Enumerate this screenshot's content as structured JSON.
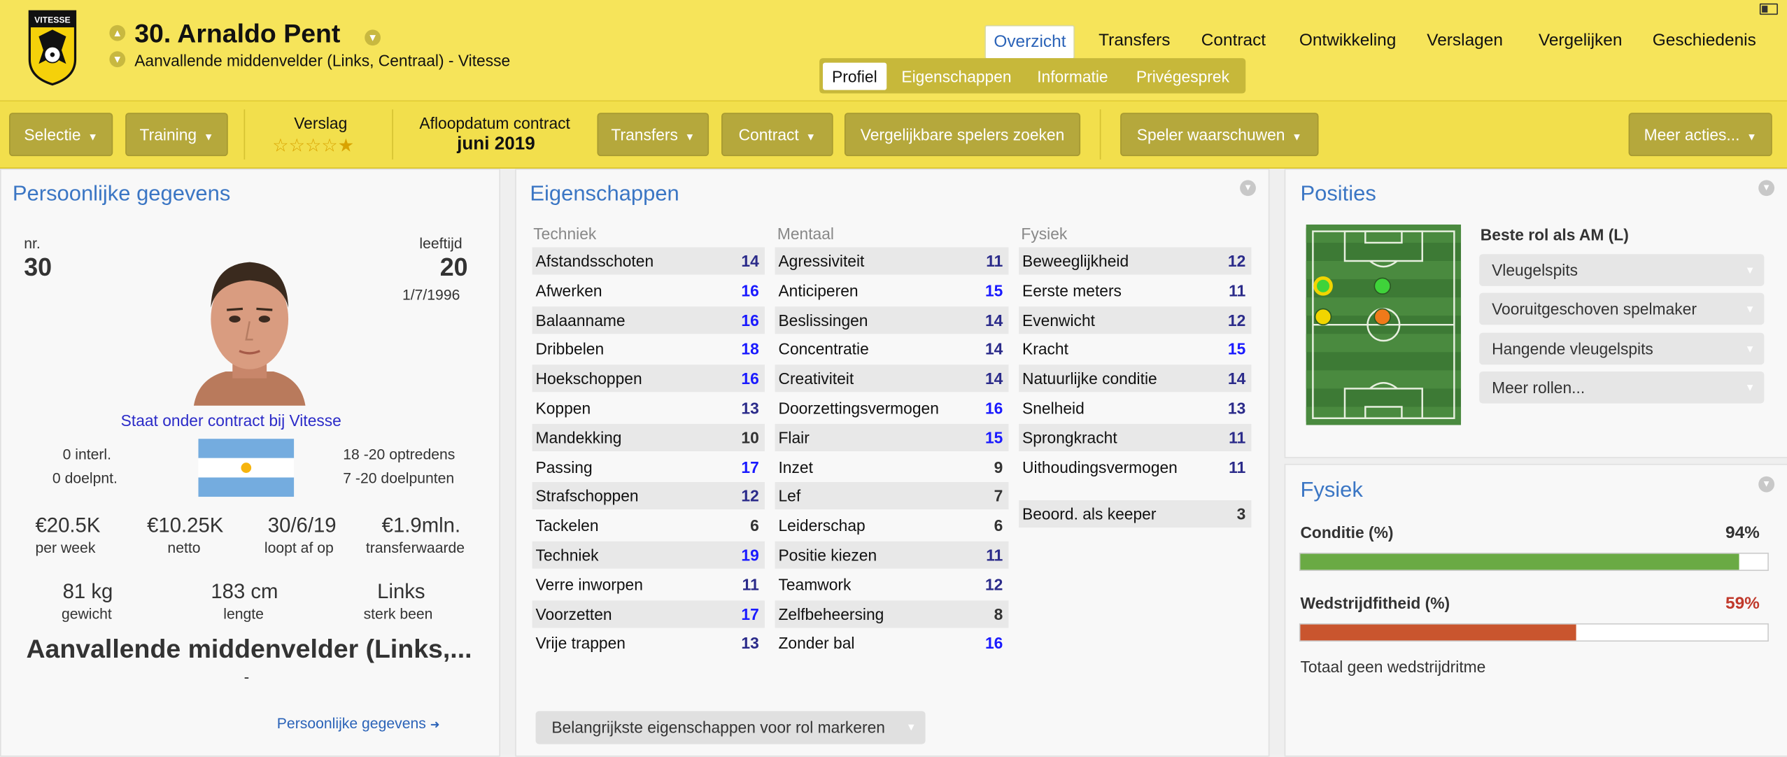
{
  "header": {
    "player_title": "30. Arnaldo Pent",
    "player_subtitle": "Aanvallende middenvelder (Links, Centraal) - Vitesse",
    "club_crest": "VITESSE",
    "nav_tabs": [
      "Overzicht",
      "Transfers",
      "Contract",
      "Ontwikkeling",
      "Verslagen",
      "Vergelijken",
      "Geschiedenis"
    ],
    "active_nav": "Overzicht",
    "sub_tabs": [
      "Profiel",
      "Eigenschappen",
      "Informatie",
      "Privégesprek"
    ],
    "active_sub": "Profiel"
  },
  "toolbar": {
    "selectie": "Selectie",
    "training": "Training",
    "verslag_label": "Verslag",
    "verslag_stars": 4.5,
    "contract_label": "Afloopdatum contract",
    "contract_value": "juni 2019",
    "transfers": "Transfers",
    "contract": "Contract",
    "vergelijkbare": "Vergelijkbare spelers zoeken",
    "waarschuwen": "Speler waarschuwen",
    "meer": "Meer acties..."
  },
  "personal": {
    "title": "Persoonlijke gegevens",
    "nr_label": "nr.",
    "nr": "30",
    "age_label": "leeftijd",
    "age": "20",
    "dob": "1/7/1996",
    "contract_status": "Staat onder contract bij Vitesse",
    "intl": "0 interl.",
    "intl_goals": "0 doelpnt.",
    "apps": "18 -20 optredens",
    "goals": "7 -20 doelpunten",
    "stats": [
      {
        "value": "€20.5K",
        "label": "per week"
      },
      {
        "value": "€10.25K",
        "label": "netto"
      },
      {
        "value": "30/6/19",
        "label": "loopt af op"
      },
      {
        "value": "€1.9mln.",
        "label": "transferwaarde"
      }
    ],
    "body": [
      {
        "value": "81 kg",
        "label": "gewicht"
      },
      {
        "value": "183 cm",
        "label": "lengte"
      },
      {
        "value": "Links",
        "label": "sterk been"
      }
    ],
    "position_big": "Aanvallende middenvelder (Links,...",
    "dash": "-",
    "link": "Persoonlijke gegevens",
    "link_arrow": "➜"
  },
  "attributes": {
    "title": "Eigenschappen",
    "techniek_head": "Techniek",
    "mentaal_head": "Mentaal",
    "fysiek_head": "Fysiek",
    "techniek": [
      {
        "name": "Afstandsschoten",
        "value": "14"
      },
      {
        "name": "Afwerken",
        "value": "16"
      },
      {
        "name": "Balaanname",
        "value": "16"
      },
      {
        "name": "Dribbelen",
        "value": "18"
      },
      {
        "name": "Hoekschoppen",
        "value": "16"
      },
      {
        "name": "Koppen",
        "value": "13"
      },
      {
        "name": "Mandekking",
        "value": "10"
      },
      {
        "name": "Passing",
        "value": "17"
      },
      {
        "name": "Strafschoppen",
        "value": "12"
      },
      {
        "name": "Tackelen",
        "value": "6"
      },
      {
        "name": "Techniek",
        "value": "19"
      },
      {
        "name": "Verre inworpen",
        "value": "11"
      },
      {
        "name": "Voorzetten",
        "value": "17"
      },
      {
        "name": "Vrije trappen",
        "value": "13"
      }
    ],
    "mentaal": [
      {
        "name": "Agressiviteit",
        "value": "11"
      },
      {
        "name": "Anticiperen",
        "value": "15"
      },
      {
        "name": "Beslissingen",
        "value": "14"
      },
      {
        "name": "Concentratie",
        "value": "14"
      },
      {
        "name": "Creativiteit",
        "value": "14"
      },
      {
        "name": "Doorzettingsvermogen",
        "value": "16"
      },
      {
        "name": "Flair",
        "value": "15"
      },
      {
        "name": "Inzet",
        "value": "9"
      },
      {
        "name": "Lef",
        "value": "7"
      },
      {
        "name": "Leiderschap",
        "value": "6"
      },
      {
        "name": "Positie kiezen",
        "value": "11"
      },
      {
        "name": "Teamwork",
        "value": "12"
      },
      {
        "name": "Zelfbeheersing",
        "value": "8"
      },
      {
        "name": "Zonder bal",
        "value": "16"
      }
    ],
    "fysiek": [
      {
        "name": "Beweeglijkheid",
        "value": "12"
      },
      {
        "name": "Eerste meters",
        "value": "11"
      },
      {
        "name": "Evenwicht",
        "value": "12"
      },
      {
        "name": "Kracht",
        "value": "15"
      },
      {
        "name": "Natuurlijke conditie",
        "value": "14"
      },
      {
        "name": "Snelheid",
        "value": "13"
      },
      {
        "name": "Sprongkracht",
        "value": "11"
      },
      {
        "name": "Uithoudingsvermogen",
        "value": "11"
      }
    ],
    "keeper_label": "Beoord. als keeper",
    "keeper_value": "3",
    "mark_button": "Belangrijkste eigenschappen voor rol markeren"
  },
  "positions": {
    "title": "Posities",
    "best_role": "Beste rol als AM (L)",
    "roles": [
      "Vleugelspits",
      "Vooruitgeschoven spelmaker",
      "Hangende vleugelspits",
      "Meer rollen..."
    ]
  },
  "fysiek_panel": {
    "title": "Fysiek",
    "conditie_label": "Conditie (%)",
    "conditie_value": "94%",
    "conditie_pct": 94,
    "wedstrijd_label": "Wedstrijdfitheid (%)",
    "wedstrijd_value": "59%",
    "wedstrijd_pct": 59,
    "note": "Totaal geen wedstrijdritme"
  },
  "colors": {
    "header_yellow": "#f6e45a",
    "olive_button": "#b5a83c",
    "title_blue": "#3b76c4",
    "high_value_blue": "#1a1aff",
    "green_bar": "#6aaa44",
    "orange_bar": "#c9552e",
    "red_text": "#c0392b"
  }
}
